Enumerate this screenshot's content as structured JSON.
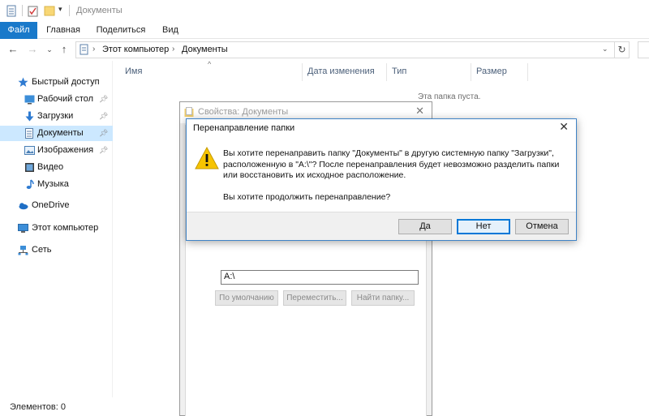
{
  "window": {
    "title": "Документы"
  },
  "ribbon": {
    "tabs": [
      "Файл",
      "Главная",
      "Поделиться",
      "Вид"
    ]
  },
  "address": {
    "crumbs": [
      "Этот компьютер",
      "Документы"
    ]
  },
  "sidebar": {
    "items": [
      {
        "label": "Быстрый доступ",
        "icon": "star-icon"
      },
      {
        "label": "Рабочий стол",
        "icon": "desktop-icon",
        "pinned": true
      },
      {
        "label": "Загрузки",
        "icon": "download-icon",
        "pinned": true
      },
      {
        "label": "Документы",
        "icon": "documents-icon",
        "pinned": true,
        "selected": true
      },
      {
        "label": "Изображения",
        "icon": "pictures-icon",
        "pinned": true
      },
      {
        "label": "Видео",
        "icon": "video-icon"
      },
      {
        "label": "Музыка",
        "icon": "music-icon"
      },
      {
        "label": "OneDrive",
        "icon": "cloud-icon"
      },
      {
        "label": "Этот компьютер",
        "icon": "computer-icon"
      },
      {
        "label": "Сеть",
        "icon": "network-icon"
      }
    ]
  },
  "columns": [
    "Имя",
    "Дата изменения",
    "Тип",
    "Размер"
  ],
  "content": {
    "empty_message": "Эта папка пуста."
  },
  "status": {
    "items_label": "Элементов: 0"
  },
  "properties_window": {
    "title": "Свойства: Документы",
    "path_value": "A:\\",
    "buttons": [
      "По умолчанию",
      "Переместить...",
      "Найти папку..."
    ]
  },
  "dialog": {
    "title": "Перенаправление папки",
    "message": "Вы хотите перенаправить папку \"Документы\" в другую системную папку \"Загрузки\", расположенную в \"A:\\\"? После перенаправления будет невозможно разделить папки или восстановить их исходное расположение.",
    "question": "Вы хотите продолжить перенаправление?",
    "buttons": {
      "yes": "Да",
      "no": "Нет",
      "cancel": "Отмена"
    }
  }
}
